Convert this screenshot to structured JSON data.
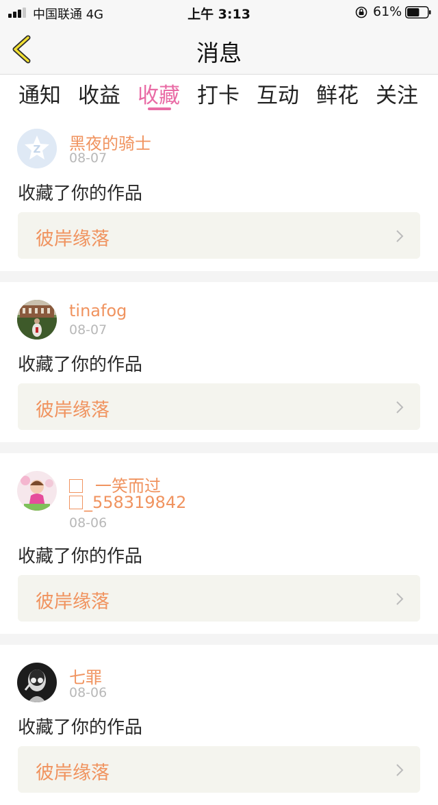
{
  "status_bar": {
    "carrier": "中国联通  4G",
    "time": "上午 3:13",
    "battery": "61%",
    "battery_level": 0.61
  },
  "header": {
    "title": "消息",
    "back_icon": "chevron-left-icon"
  },
  "tabs": [
    {
      "label": "通知"
    },
    {
      "label": "收益"
    },
    {
      "label": "收藏",
      "active": true
    },
    {
      "label": "打卡"
    },
    {
      "label": "互动"
    },
    {
      "label": "鲜花"
    },
    {
      "label": "关注"
    }
  ],
  "items": [
    {
      "username": "黑夜的骑士",
      "date": "08-07",
      "action": "收藏了你的作品",
      "work": "彼岸缘落"
    },
    {
      "username": "tinafog",
      "date": "08-07",
      "action": "收藏了你的作品",
      "work": "彼岸缘落"
    },
    {
      "username_line1": "一笑而过",
      "username_line2": "_558319842",
      "date": "08-06",
      "action": "收藏了你的作品",
      "work": "彼岸缘落"
    },
    {
      "username": "七罪",
      "date": "08-06",
      "action": "收藏了你的作品",
      "work": "彼岸缘落"
    }
  ],
  "colors": {
    "accent": "#e96ba5",
    "username": "#f0935f",
    "date": "#b8b8b8",
    "work_bg": "#f4f4ee"
  }
}
